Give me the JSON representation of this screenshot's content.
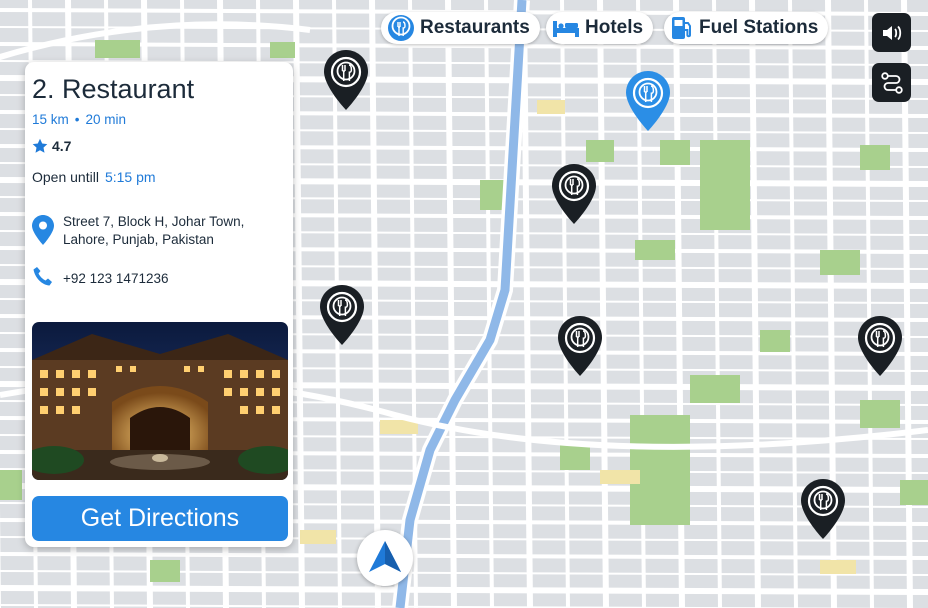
{
  "filters": [
    {
      "label": "Restaurants",
      "icon": "restaurant-icon"
    },
    {
      "label": "Hotels",
      "icon": "bed-icon"
    },
    {
      "label": "Fuel Stations",
      "icon": "fuel-pump-icon"
    }
  ],
  "controls": {
    "sound_icon": "speaker-icon",
    "route_icon": "route-icon"
  },
  "place": {
    "title": "2. Restaurant",
    "distance": "15 km",
    "separator": "•",
    "duration": "20 min",
    "rating": "4.7",
    "open_label": "Open untill",
    "open_time": "5:15 pm",
    "address_line1": "Street 7, Block H, Johar Town,",
    "address_line2": "Lahore, Punjab, Pakistan",
    "phone": "+92 123 1471236",
    "button": "Get Directions"
  },
  "colors": {
    "accent": "#2687e2",
    "pin_dark": "#1a1f24",
    "pin_selected": "#2b8ee6",
    "map_road": "#ffffff",
    "map_block": "#dfe2e6",
    "park": "#a8d08d",
    "highway": "#8fb8e8"
  }
}
